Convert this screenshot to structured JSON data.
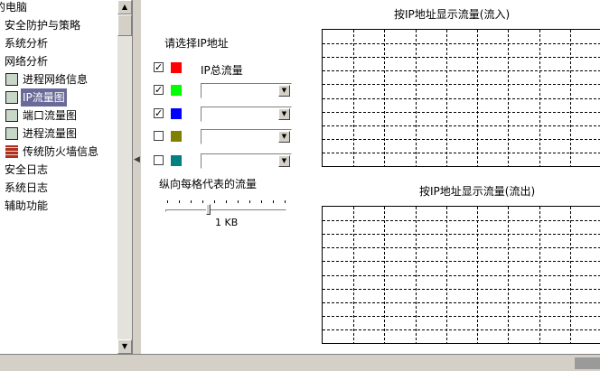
{
  "tree": {
    "items": [
      {
        "label": "的电脑",
        "icon": "computer-icon",
        "indent": 0
      },
      {
        "label": "安全防护与策略",
        "icon": "folder-icon",
        "indent": 0
      },
      {
        "label": "系统分析",
        "icon": "folder-icon",
        "indent": 0
      },
      {
        "label": "网络分析",
        "icon": "folder-icon",
        "indent": 0
      },
      {
        "label": "进程网络信息",
        "icon": "process-network-icon",
        "indent": 1
      },
      {
        "label": "IP流量图",
        "icon": "ip-traffic-icon",
        "indent": 1
      },
      {
        "label": "端口流量图",
        "icon": "port-traffic-icon",
        "indent": 1
      },
      {
        "label": "进程流量图",
        "icon": "process-traffic-icon",
        "indent": 1
      },
      {
        "label": "传统防火墙信息",
        "icon": "firewall-icon",
        "indent": 1
      },
      {
        "label": "安全日志",
        "icon": "folder-icon",
        "indent": 0
      },
      {
        "label": "系统日志",
        "icon": "folder-icon",
        "indent": 0
      },
      {
        "label": "辅助功能",
        "icon": "folder-icon",
        "indent": 0
      }
    ],
    "selected_index": 5
  },
  "panel": {
    "select_ip_label": "请选择IP地址",
    "ip_total_label": "IP总流量",
    "rows": [
      {
        "checked": true,
        "check_mark": "✓",
        "color": "#ff0000"
      },
      {
        "checked": true,
        "check_mark": "✓",
        "color": "#00ff00",
        "combo_value": ""
      },
      {
        "checked": true,
        "check_mark": "✓",
        "color": "#0000ff",
        "combo_value": ""
      },
      {
        "checked": false,
        "check_mark": "",
        "color": "#808000",
        "combo_value": ""
      },
      {
        "checked": false,
        "check_mark": "",
        "color": "#008080",
        "combo_value": ""
      }
    ],
    "scale_label": "纵向每格代表的流量",
    "scale_value": "1 KB",
    "slider_fraction": 0.35
  },
  "charts": {
    "inbound_title": "按IP地址显示流量(流入)",
    "outbound_title": "按IP地址显示流量(流出)"
  },
  "colors": {
    "selection": "#6a6a9a",
    "window_bg": "#d4d0c8"
  }
}
